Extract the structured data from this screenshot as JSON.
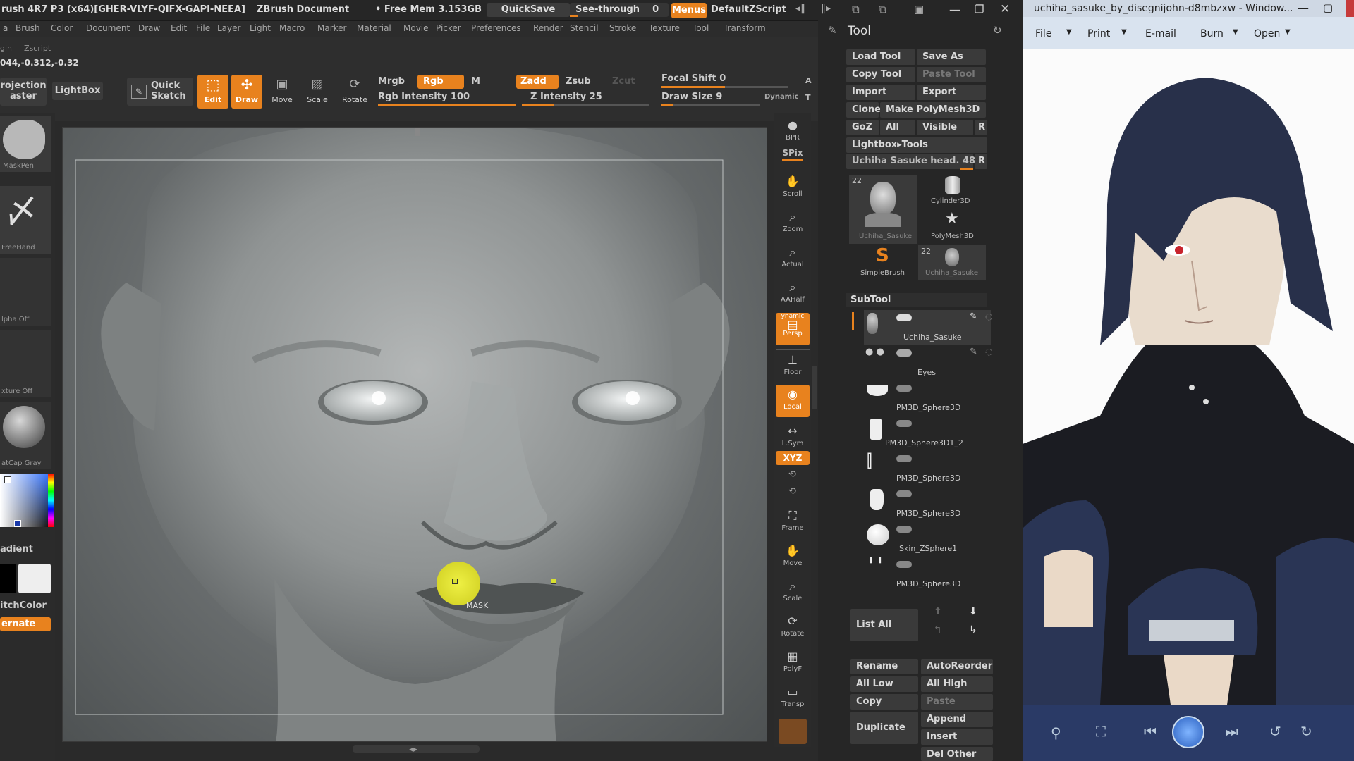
{
  "zbrush": {
    "title_left": "rush 4R7 P3 (x64)[GHER-VLYF-QIFX-GAPI-NEEA]",
    "title_doc": "ZBrush Document",
    "free_mem": "• Free Mem 3.153GB",
    "quicksave": "QuickSave",
    "see_through": "See-through",
    "see_through_value": "0",
    "menus": "Menus",
    "default_zscript": "DefaultZScript",
    "menu_items": [
      "a",
      "Brush",
      "Color",
      "Document",
      "Draw",
      "Edit",
      "File",
      "Layer",
      "Light",
      "Macro",
      "Marker",
      "Material",
      "Movie",
      "Picker",
      "Preferences",
      "Render",
      "Stencil",
      "Stroke",
      "Texture",
      "Tool",
      "Transform"
    ],
    "menu_items_row2": [
      "gin",
      "Zscript"
    ],
    "coords": "044,-0.312,-0.32",
    "projection_master": "rojection\naster",
    "lightbox": "LightBox",
    "quick_sketch": "Quick\nSketch",
    "edit": "Edit",
    "draw": "Draw",
    "move": "Move",
    "scale": "Scale",
    "rotate": "Rotate",
    "mrgb": "Mrgb",
    "rgb": "Rgb",
    "m": "M",
    "zadd": "Zadd",
    "zsub": "Zsub",
    "zcut": "Zcut",
    "rgb_intensity": "Rgb Intensity 100",
    "rgb_intensity_value": 100,
    "z_intensity": "Z Intensity 25",
    "z_intensity_value": 25,
    "focal_shift": "Focal Shift 0",
    "draw_size": "Draw Size 9",
    "dynamic": "Dynamic",
    "a_label": "A",
    "t_label": "T",
    "left_labels": {
      "maskpen": "MaskPen",
      "freehand": "FreeHand",
      "alpha_off": "lpha Off",
      "texture_off": "xture Off",
      "matcap": "atCap Gray",
      "gradient": "adient",
      "switch_color": "itchColor",
      "alternate": "ernate"
    },
    "shelf": [
      "BPR",
      "SPix",
      "Scroll",
      "Zoom",
      "Actual",
      "AAHalf",
      "Persp",
      "Floor",
      "Local",
      "L.Sym",
      "Frame",
      "Move",
      "Scale",
      "Rotate",
      "PolyF",
      "Transp"
    ],
    "shelf_dynamic": "ynamic",
    "shelf_xyz": "XYZ",
    "cursor_label": "MASK"
  },
  "tool_panel": {
    "title": "Tool",
    "buttons": [
      [
        "Load Tool",
        "Save As"
      ],
      [
        "Copy Tool",
        "Paste Tool"
      ],
      [
        "Import",
        "Export"
      ],
      [
        "Clone",
        "Make PolyMesh3D"
      ],
      [
        "GoZ",
        "All",
        "Visible",
        "R"
      ]
    ],
    "lightbox_tools": "Lightbox▸Tools",
    "current_tool": "Uchiha Sasuke head. 48",
    "current_tool_r": "R",
    "thumbs": {
      "count1": "22",
      "t1": "Uchiha_Sasuke",
      "t2": "Cylinder3D",
      "t3": "PolyMesh3D",
      "t4": "SimpleBrush",
      "count2": "22",
      "t5": "Uchiha_Sasuke"
    },
    "subtool_title": "SubTool",
    "subtools": [
      "Uchiha_Sasuke",
      "Eyes",
      "PM3D_Sphere3D",
      "PM3D_Sphere3D1_2",
      "PM3D_Sphere3D",
      "PM3D_Sphere3D",
      "Skin_ZSphere1",
      "PM3D_Sphere3D"
    ],
    "list_all": "List All",
    "bottom": [
      [
        "Rename",
        "AutoReorder"
      ],
      [
        "All Low",
        "All High"
      ],
      [
        "Copy",
        "Paste"
      ],
      [
        "Duplicate",
        "Append"
      ],
      [
        "",
        "Insert"
      ],
      [
        "",
        "Del Other"
      ]
    ]
  },
  "viewer": {
    "title": "uchiha_sasuke_by_disegnijohn-d8mbzxw - Window...",
    "menu": [
      "File",
      "Print",
      "E-mail",
      "Burn",
      "Open"
    ]
  },
  "colors": {
    "accent": "#e8821e",
    "panel": "#262626",
    "viewer_bar": "#2a3a66"
  }
}
